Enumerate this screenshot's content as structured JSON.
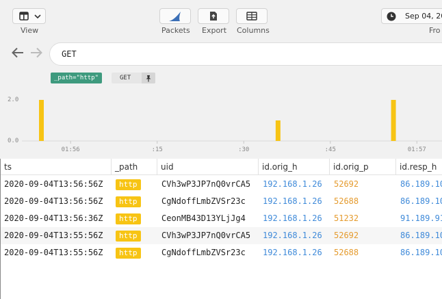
{
  "toolbar": {
    "view_label": "View",
    "packets_label": "Packets",
    "export_label": "Export",
    "columns_label": "Columns",
    "date_text": "Sep 04, 20",
    "from_label": "Fro"
  },
  "search": {
    "query": "GET"
  },
  "pins": {
    "path_filter": "_path=\"http\"",
    "get_pin": "GET"
  },
  "chart_data": {
    "type": "bar",
    "ylim": [
      0,
      2
    ],
    "yticks": [
      "2.0",
      "0.0"
    ],
    "xticks": [
      "01:56",
      ":15",
      ":30",
      ":45",
      "01:57"
    ],
    "bars": [
      {
        "x": "2020-09-04T13:55:55Z",
        "y": 2
      },
      {
        "x": "2020-09-04T13:56:36Z",
        "y": 1
      },
      {
        "x": "2020-09-04T13:56:56Z",
        "y": 2
      }
    ],
    "bar_color": "#f7c414",
    "grid": false
  },
  "table": {
    "columns": [
      "ts",
      "_path",
      "uid",
      "id.orig_h",
      "id.orig_p",
      "id.resp_h"
    ],
    "rows": [
      {
        "ts": "2020-09-04T13:56:56Z",
        "path": "http",
        "uid": "CVh3wP3JP7nQ0vrCA5",
        "orig_h": "192.168.1.26",
        "orig_p": "52692",
        "resp_h": "86.189.10"
      },
      {
        "ts": "2020-09-04T13:56:56Z",
        "path": "http",
        "uid": "CgNdoffLmbZVSr23c",
        "orig_h": "192.168.1.26",
        "orig_p": "52688",
        "resp_h": "86.189.10"
      },
      {
        "ts": "2020-09-04T13:56:36Z",
        "path": "http",
        "uid": "CeonMB43D13YLjJg4",
        "orig_h": "192.168.1.26",
        "orig_p": "51232",
        "resp_h": "91.189.91"
      },
      {
        "ts": "2020-09-04T13:55:56Z",
        "path": "http",
        "uid": "CVh3wP3JP7nQ0vrCA5",
        "orig_h": "192.168.1.26",
        "orig_p": "52692",
        "resp_h": "86.189.10"
      },
      {
        "ts": "2020-09-04T13:55:56Z",
        "path": "http",
        "uid": "CgNdoffLmbZVSr23c",
        "orig_h": "192.168.1.26",
        "orig_p": "52688",
        "resp_h": "86.189.10"
      }
    ]
  },
  "icons": [
    "layout-icon",
    "chevron-down-icon",
    "shark-fin-icon",
    "export-file-icon",
    "columns-table-icon",
    "clock-icon",
    "back-arrow-icon",
    "forward-arrow-icon",
    "pin-icon"
  ]
}
